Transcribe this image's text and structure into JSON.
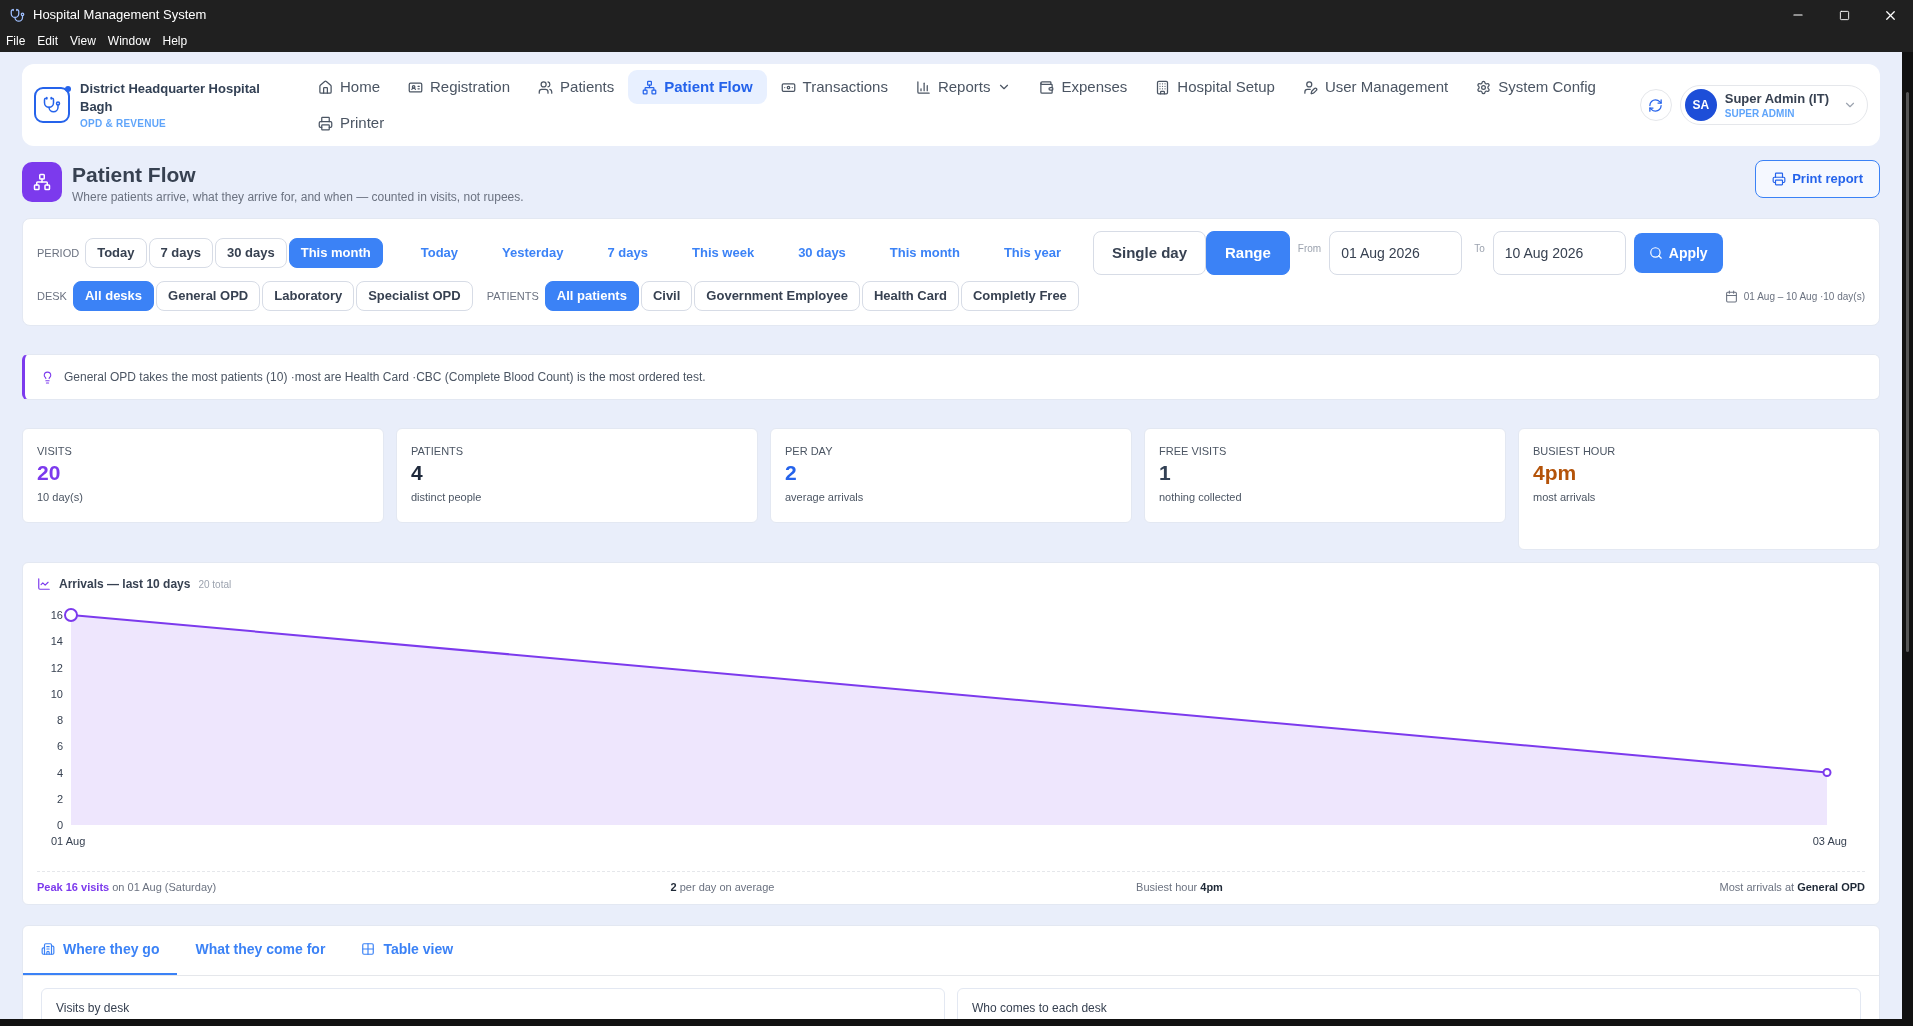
{
  "window": {
    "title": "Hospital Management System",
    "menu": [
      "File",
      "Edit",
      "View",
      "Window",
      "Help"
    ]
  },
  "brand": {
    "name": "District Headquarter Hospital Bagh",
    "subtitle": "OPD & REVENUE"
  },
  "nav": [
    {
      "label": "Home",
      "selected": false
    },
    {
      "label": "Registration",
      "selected": false
    },
    {
      "label": "Patients",
      "selected": false
    },
    {
      "label": "Patient Flow",
      "selected": true
    },
    {
      "label": "Transactions",
      "selected": false
    },
    {
      "label": "Reports",
      "selected": false,
      "has_menu": true
    },
    {
      "label": "Expenses",
      "selected": false
    },
    {
      "label": "Hospital Setup",
      "selected": false
    },
    {
      "label": "User Management",
      "selected": false
    },
    {
      "label": "System Config",
      "selected": false
    },
    {
      "label": "Printer",
      "selected": false
    }
  ],
  "user": {
    "initials": "SA",
    "name": "Super Admin (IT)",
    "role": "SUPER ADMIN"
  },
  "page": {
    "title": "Patient Flow",
    "subtitle": "Where patients arrive, what they arrive for, and when — counted in visits, not rupees.",
    "print_button": "Print report"
  },
  "period": {
    "label": "PERIOD",
    "presets": [
      {
        "label": "Today",
        "selected": false
      },
      {
        "label": "7 days",
        "selected": false
      },
      {
        "label": "30 days",
        "selected": false
      },
      {
        "label": "This month",
        "selected": true
      }
    ],
    "quick": [
      "Today",
      "Yesterday",
      "7 days",
      "This week",
      "30 days",
      "This month",
      "This year"
    ],
    "modes": [
      {
        "label": "Single day",
        "selected": false
      },
      {
        "label": "Range",
        "selected": true
      }
    ],
    "from": {
      "label": "From",
      "value": "01 Aug 2026"
    },
    "to": {
      "label": "To",
      "value": "10 Aug 2026"
    },
    "apply": "Apply"
  },
  "desk": {
    "label": "DESK",
    "options": [
      {
        "label": "All desks",
        "selected": true
      },
      {
        "label": "General OPD",
        "selected": false
      },
      {
        "label": "Laboratory",
        "selected": false
      },
      {
        "label": "Specialist OPD",
        "selected": false
      }
    ]
  },
  "patients": {
    "label": "PATIENTS",
    "options": [
      {
        "label": "All patients",
        "selected": true
      },
      {
        "label": "Civil",
        "selected": false
      },
      {
        "label": "Government Employee",
        "selected": false
      },
      {
        "label": "Health Card",
        "selected": false
      },
      {
        "label": "Completly Free",
        "selected": false
      }
    ]
  },
  "range_summary": "01 Aug – 10 Aug ·10 day(s)",
  "insight": "General OPD takes the most patients (10) ·most are Health Card ·CBC (Complete Blood Count) is the most ordered test.",
  "stats": [
    {
      "label": "VISITS",
      "value": "20",
      "note": "10 day(s)",
      "color": "#7c3aed"
    },
    {
      "label": "PATIENTS",
      "value": "4",
      "note": "distinct people",
      "color": "#1e293b"
    },
    {
      "label": "PER DAY",
      "value": "2",
      "note": "average arrivals",
      "color": "#2563eb"
    },
    {
      "label": "FREE VISITS",
      "value": "1",
      "note": "nothing collected",
      "color": "#334155"
    },
    {
      "label": "BUSIEST HOUR",
      "value": "4pm",
      "note": "most arrivals",
      "color": "#b45309"
    }
  ],
  "arrivals": {
    "title": "Arrivals — last 10 days",
    "total": "20 total",
    "chart_data": {
      "type": "area",
      "categories": [
        "01 Aug",
        "03 Aug"
      ],
      "series": [
        {
          "color": "#7c3aed",
          "values": [
            16,
            4
          ]
        }
      ],
      "ylim": [
        0,
        16
      ],
      "yticks": [
        0,
        2,
        4,
        6,
        8,
        10,
        12,
        14,
        16
      ]
    },
    "footer": [
      {
        "kind": "peak",
        "text": "**Peak 16 visits** on 01 Aug (Saturday)"
      },
      {
        "kind": "stat",
        "text": "**2** per day on average"
      },
      {
        "kind": "stat",
        "text": "Busiest hour **4pm**"
      },
      {
        "kind": "stat",
        "text": "Most arrivals at **General OPD**"
      }
    ]
  },
  "tabs": [
    {
      "label": "Where they go",
      "selected": true
    },
    {
      "label": "What they come for",
      "selected": false
    },
    {
      "label": "Table view",
      "selected": false
    }
  ],
  "panels": [
    "Visits by desk",
    "Who comes to each desk"
  ]
}
